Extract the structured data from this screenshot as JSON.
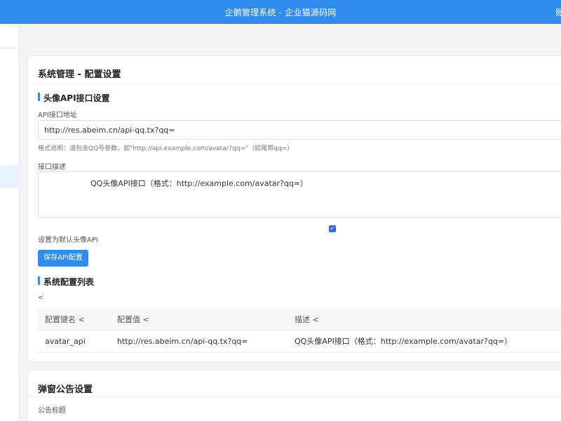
{
  "header": {
    "title": "企鹅管理系统 - 企业猫源码网",
    "user_partial": "账"
  },
  "config_card": {
    "title": "系统管理 - 配置设置",
    "avatar_section": {
      "title": "头像API接口设置",
      "api_url_label": "API接口地址",
      "api_url_value": "http://res.abeim.cn/api-qq.tx?qq=",
      "api_url_hint": "格式说明：请包含QQ号参数，如\"http://api.example.com/avatar?qq=\"（结尾带qq=）",
      "desc_label": "接口描述",
      "desc_value": "QQ头像API接口（格式：http://example.com/avatar?qq=）",
      "default_label": "设置为默认头像API",
      "default_checked": true,
      "save_button": "保存API配置"
    },
    "list_section": {
      "title": "系统配置列表",
      "back_symbol": "<",
      "columns": [
        "配置键名 <",
        "配置值 <",
        "描述 <"
      ],
      "rows": [
        [
          "avatar_api",
          "http://res.abeim.cn/api-qq.tx?qq=",
          "QQ头像API接口（格式：http://example.com/avatar?qq=）"
        ]
      ]
    }
  },
  "popup_card": {
    "title": "弹窗公告设置",
    "notice_title_label": "公告标题"
  },
  "colors": {
    "primary": "#2f8cf0",
    "background": "#f3f4f6"
  }
}
